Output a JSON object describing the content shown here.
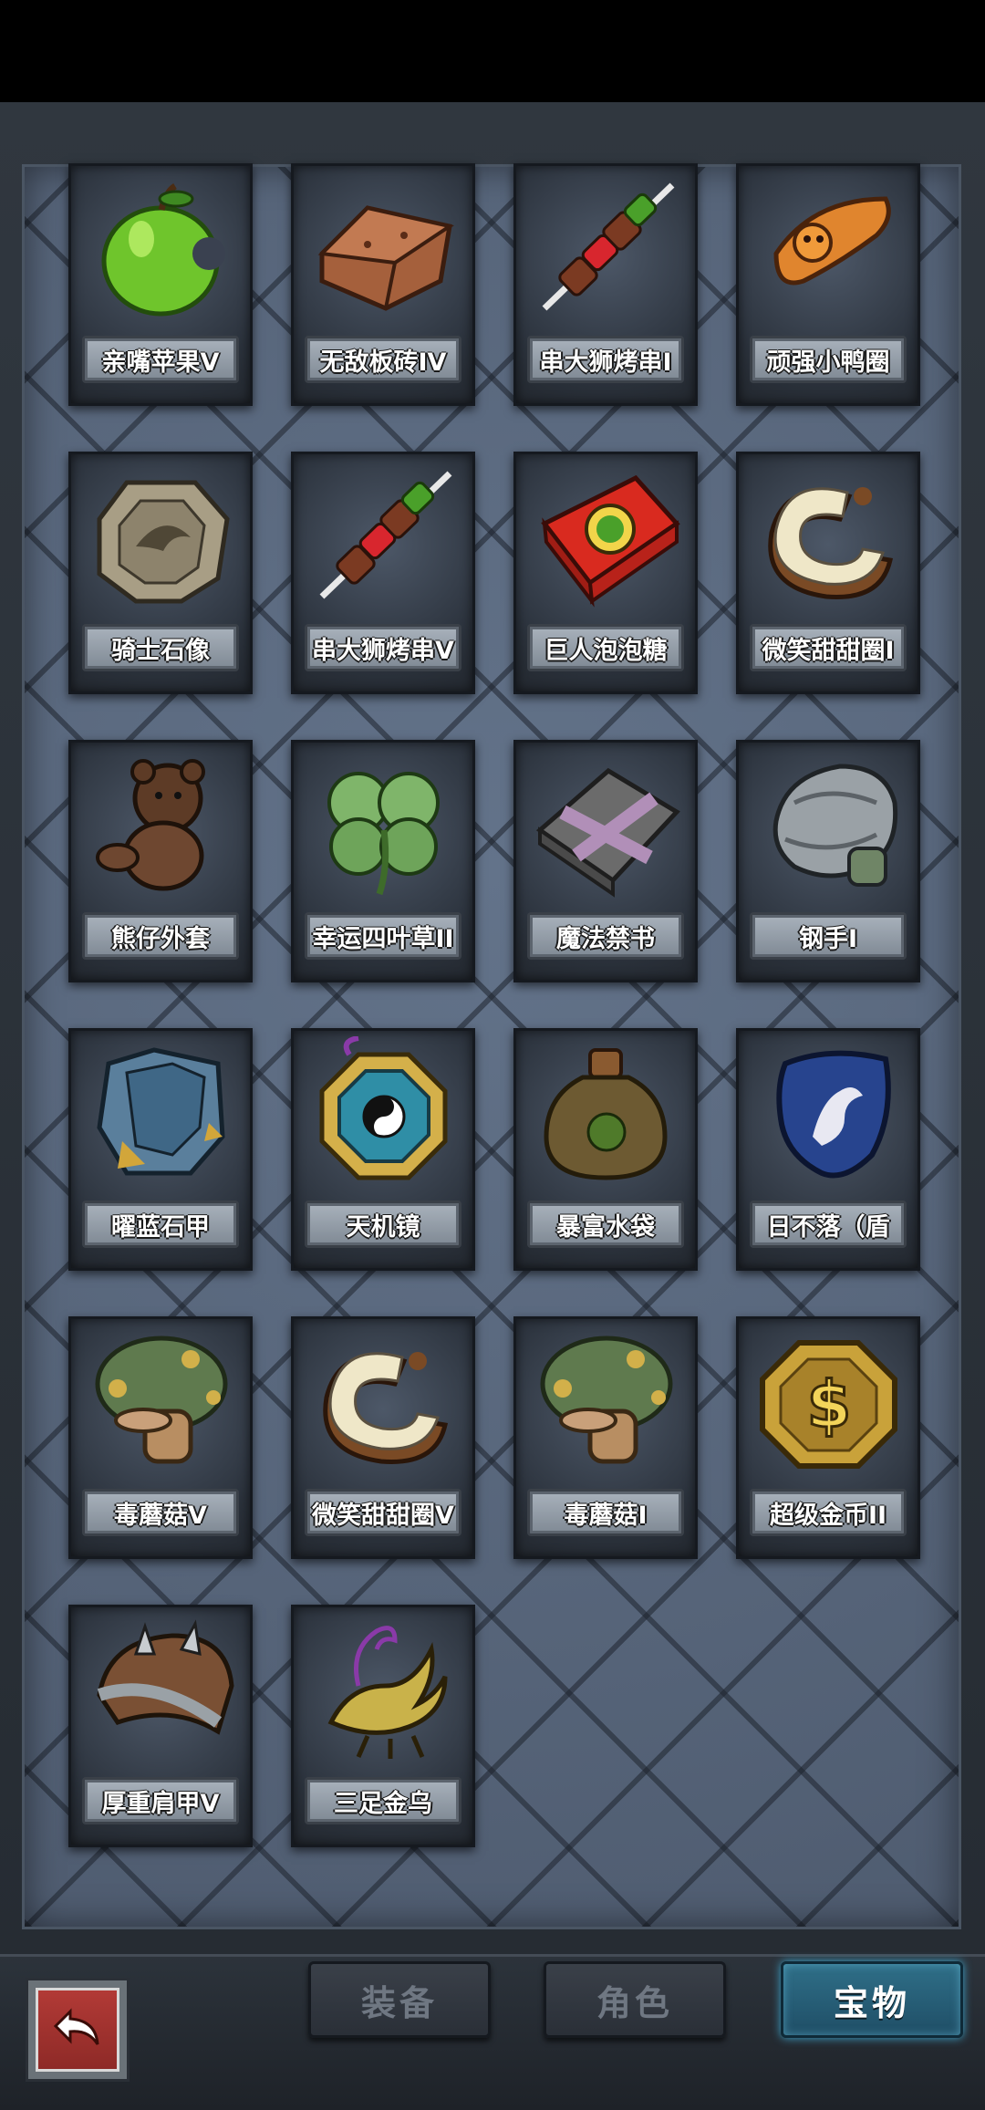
{
  "items": [
    {
      "name": "亲嘴苹果V",
      "icon": "green-apple-icon"
    },
    {
      "name": "无敌板砖IV",
      "icon": "brick-icon"
    },
    {
      "name": "串大狮烤串I",
      "icon": "kebab-icon"
    },
    {
      "name": "顽强小鸭圈",
      "icon": "duck-ring-icon"
    },
    {
      "name": "骑士石像",
      "icon": "knight-stone-tablet-icon"
    },
    {
      "name": "串大狮烤串V",
      "icon": "kebab-icon"
    },
    {
      "name": "巨人泡泡糖",
      "icon": "bubble-gum-box-icon"
    },
    {
      "name": "微笑甜甜圈I",
      "icon": "donut-icon"
    },
    {
      "name": "熊仔外套",
      "icon": "teddy-bear-icon"
    },
    {
      "name": "幸运四叶草II",
      "icon": "four-leaf-clover-icon"
    },
    {
      "name": "魔法禁书",
      "icon": "forbidden-book-icon"
    },
    {
      "name": "钢手I",
      "icon": "steel-gauntlet-icon"
    },
    {
      "name": "曜蓝石甲",
      "icon": "blue-armor-icon"
    },
    {
      "name": "天机镜",
      "icon": "bagua-mirror-icon"
    },
    {
      "name": "暴富水袋",
      "icon": "water-pouch-icon"
    },
    {
      "name": "日不落（盾",
      "icon": "shield-icon"
    },
    {
      "name": "毒蘑菇V",
      "icon": "poison-mushroom-icon"
    },
    {
      "name": "微笑甜甜圈V",
      "icon": "donut-icon"
    },
    {
      "name": "毒蘑菇I",
      "icon": "poison-mushroom-icon"
    },
    {
      "name": "超级金币II",
      "icon": "gold-coin-icon"
    },
    {
      "name": "厚重肩甲V",
      "icon": "spiked-pauldron-icon"
    },
    {
      "name": "三足金乌",
      "icon": "golden-crow-icon"
    }
  ],
  "tabs": [
    {
      "label": "装备",
      "active": false
    },
    {
      "label": "角色",
      "active": false
    },
    {
      "label": "宝物",
      "active": true
    }
  ],
  "back_button": {
    "icon": "back-arrow-icon"
  },
  "colors": {
    "active_tab": "#2f6f88",
    "accent_red": "#b23a36"
  }
}
